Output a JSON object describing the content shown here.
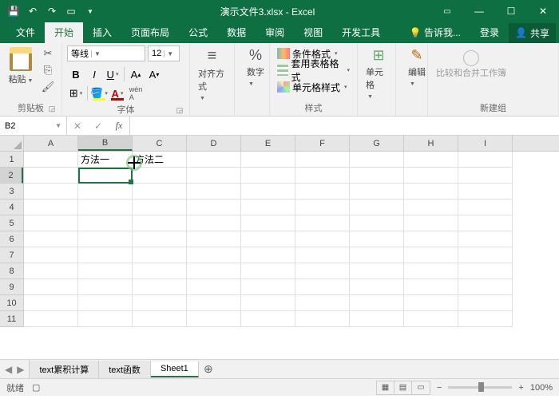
{
  "title": "演示文件3.xlsx - Excel",
  "tabs": {
    "file": "文件",
    "home": "开始",
    "insert": "插入",
    "layout": "页面布局",
    "formulas": "公式",
    "data": "数据",
    "review": "审阅",
    "view": "视图",
    "dev": "开发工具",
    "tell": "告诉我...",
    "login": "登录",
    "share": "共享"
  },
  "ribbon": {
    "paste": "粘贴",
    "clipboard": "剪贴板",
    "font_name": "等线",
    "font_size": "12",
    "font_group": "字体",
    "align": "对齐方式",
    "number": "数字",
    "cond_fmt": "条件格式",
    "table_fmt": "套用表格格式",
    "cell_fmt": "单元格样式",
    "styles": "样式",
    "cells": "单元格",
    "edit": "编辑",
    "compare": "比较和合并工作簿",
    "newgroup": "新建组"
  },
  "namebox": "B2",
  "columns": [
    "A",
    "B",
    "C",
    "D",
    "E",
    "F",
    "G",
    "H",
    "I"
  ],
  "rows": [
    "1",
    "2",
    "3",
    "4",
    "5",
    "6",
    "7",
    "8",
    "9",
    "10",
    "11"
  ],
  "cells": {
    "B1": "方法一",
    "C1": "方法二"
  },
  "sheets": {
    "s1": "text累积计算",
    "s2": "text函数",
    "s3": "Sheet1"
  },
  "status": {
    "ready": "就绪",
    "rec": "",
    "zoom": "100%"
  }
}
